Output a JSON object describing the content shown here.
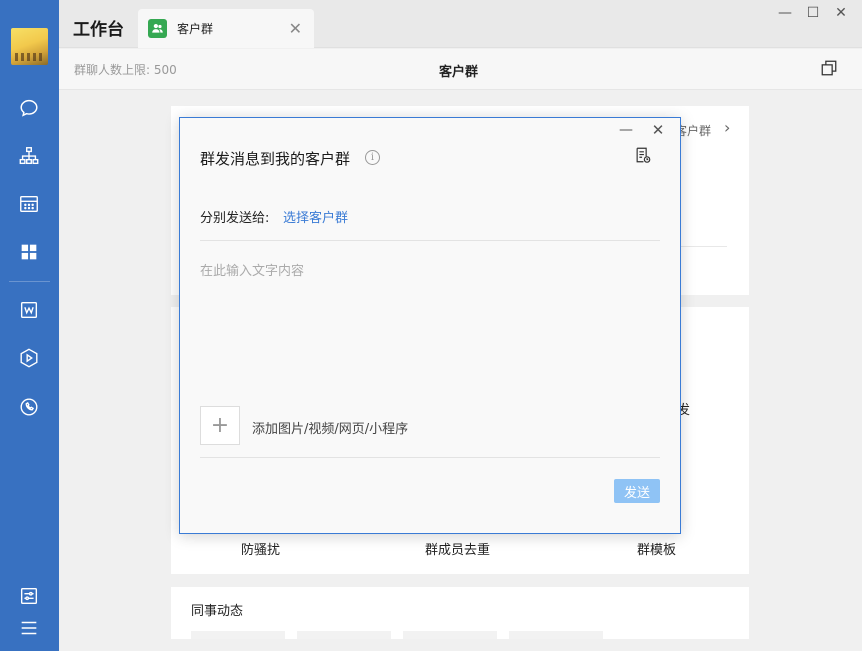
{
  "topbar": {
    "workbench_title": "工作台",
    "tab_label": "客户群",
    "tab_close": "✕",
    "minimize": "—",
    "maximize": "☐",
    "close": "✕"
  },
  "subbar": {
    "limit_text": "群聊人数上限: 500",
    "page_title": "客户群"
  },
  "background": {
    "breadcrumb_partial": "客户群",
    "chevron": "›",
    "partial_label_1": "发",
    "partial_label_2": "‹",
    "feature_1": "防骚扰",
    "feature_2": "群成员去重",
    "feature_3": "群模板",
    "colleague_news": "同事动态"
  },
  "dialog": {
    "title": "群发消息到我的客户群",
    "info_glyph": "i",
    "minimize": "—",
    "close": "✕",
    "send_to_label": "分别发送给:",
    "select_link": "选择客户群",
    "text_placeholder": "在此输入文字内容",
    "add_glyph": "+",
    "add_label": "添加图片/视频/网页/小程序",
    "send_label": "发送"
  },
  "icons": {
    "sidebar": [
      "chat-icon",
      "org-chart-icon",
      "calendar-icon",
      "apps-grid-icon",
      "doc-w-icon",
      "play-cube-icon",
      "phone-cloud-icon",
      "settings-sliders-icon",
      "menu-icon"
    ]
  },
  "colors": {
    "sidebar_bg": "#3871c1",
    "accent": "#3a7bd5",
    "send_button": "#8fc3f5",
    "tab_icon": "#35a852"
  }
}
